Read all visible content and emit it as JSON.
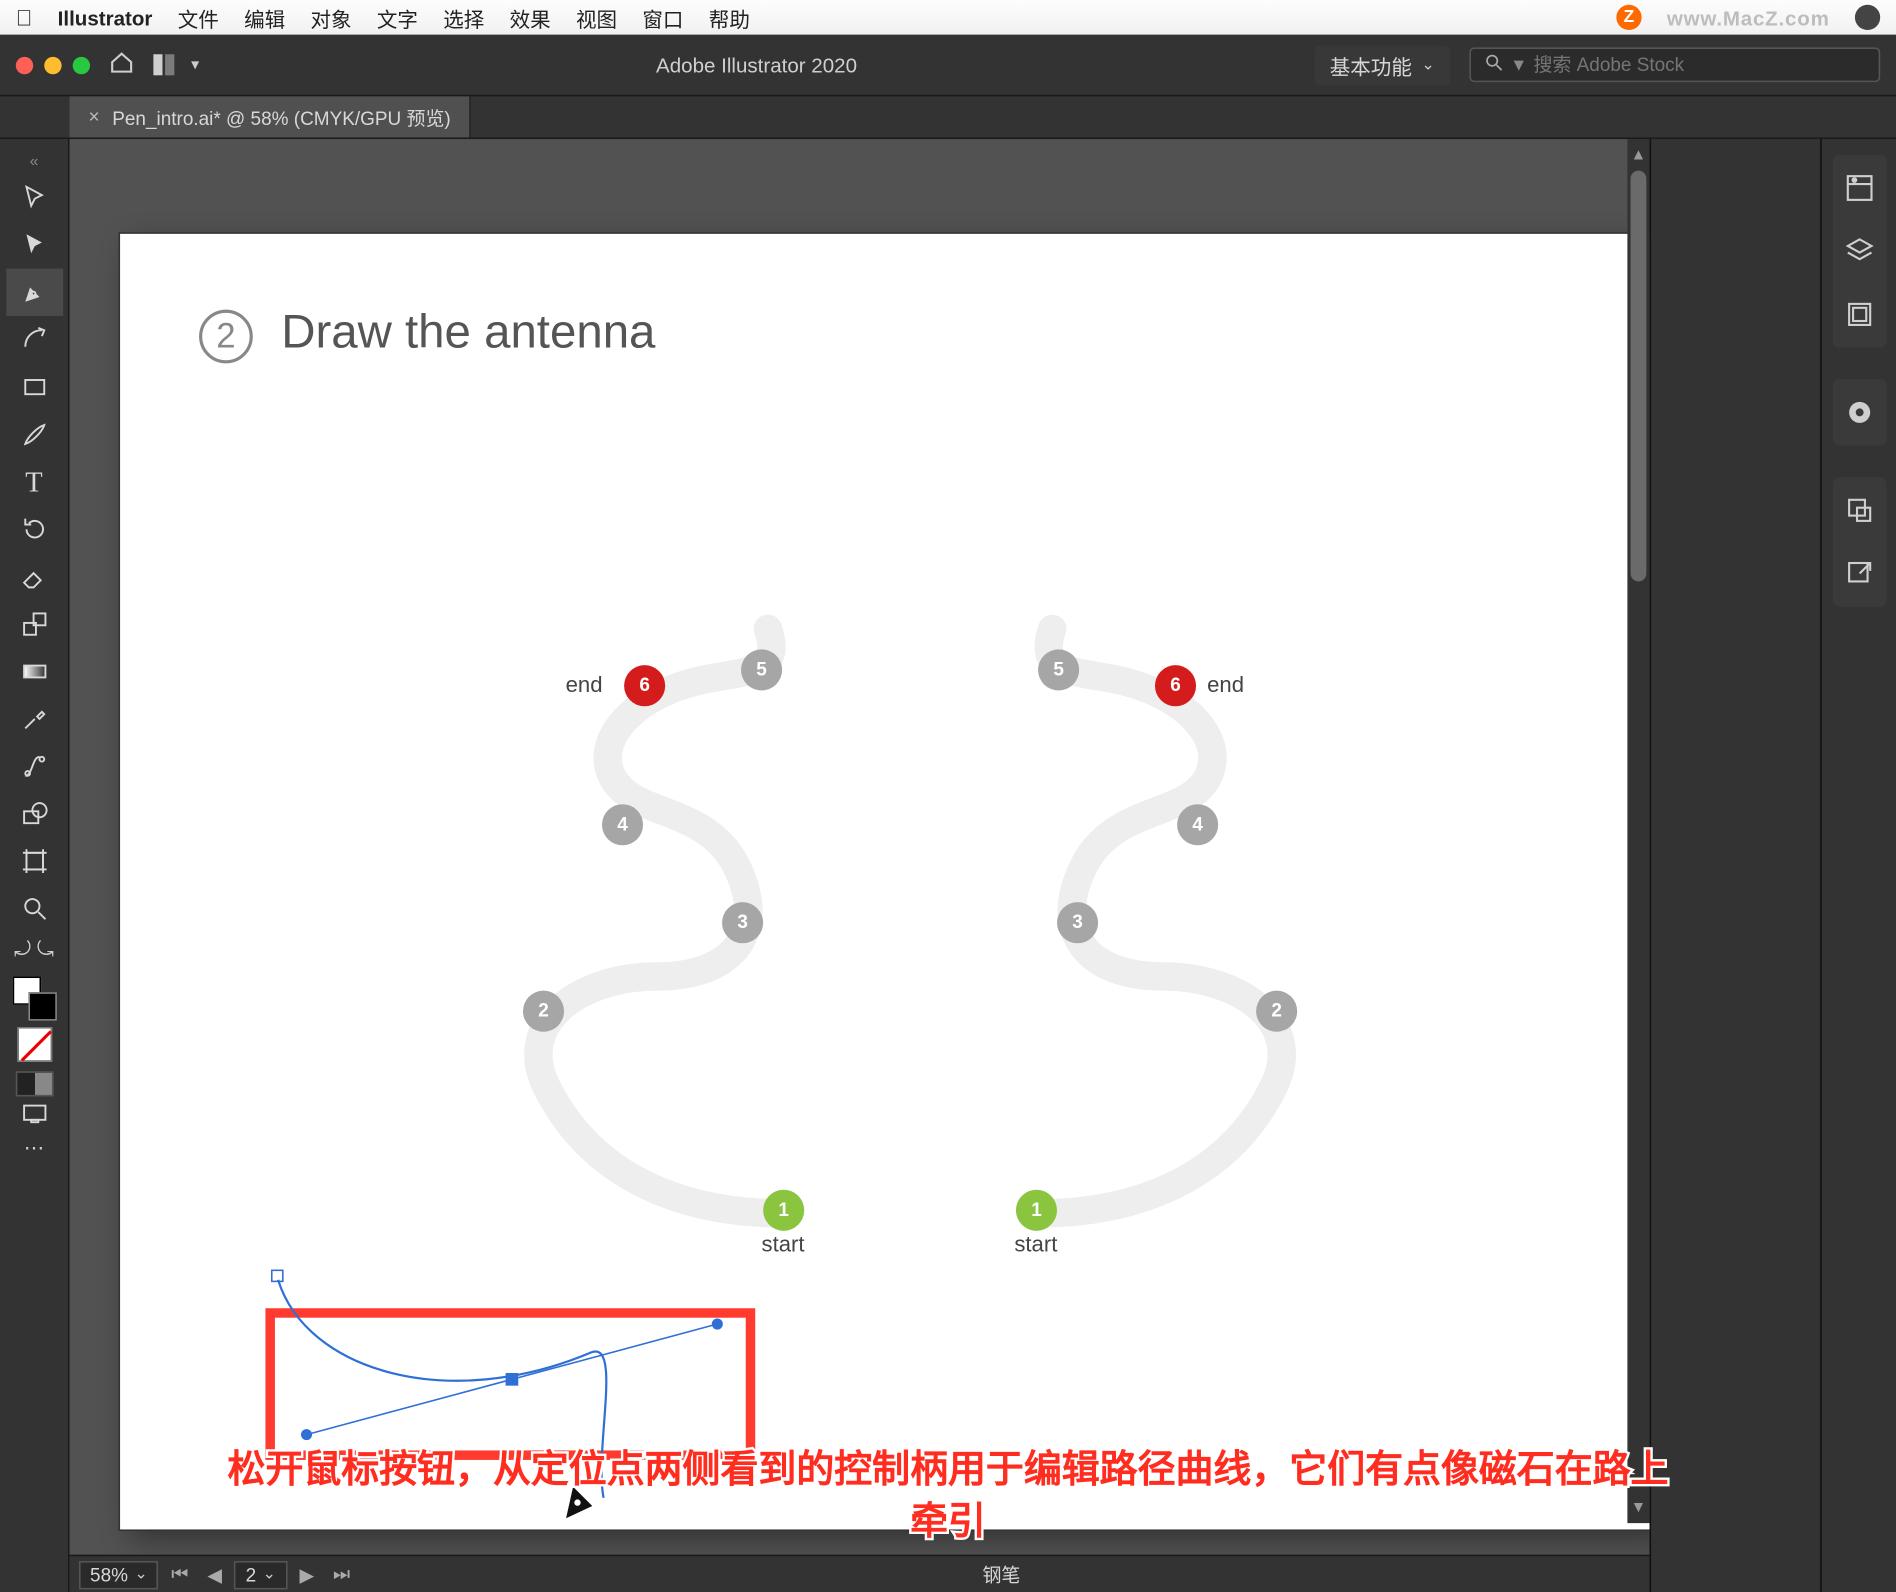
{
  "menubar": {
    "app": "Illustrator",
    "items": [
      "文件",
      "编辑",
      "对象",
      "文字",
      "选择",
      "效果",
      "视图",
      "窗口",
      "帮助"
    ],
    "watermark": "www.MacZ.com",
    "z": "Z"
  },
  "titlebar": {
    "app_title": "Adobe Illustrator 2020",
    "workspace": "基本功能",
    "search_placeholder": "搜索 Adobe Stock"
  },
  "tab": {
    "name": "Pen_intro.ai* @ 58% (CMYK/GPU 预览)"
  },
  "canvas": {
    "heading_num": "2",
    "heading": "Draw the antenna",
    "nodes": {
      "n1": "1",
      "n2": "2",
      "n3": "3",
      "n4": "4",
      "n5": "5",
      "n6": "6",
      "start": "start",
      "end": "end"
    }
  },
  "status": {
    "zoom": "58%",
    "page": "2",
    "tool": "钢笔"
  },
  "caption": {
    "line1": "松开鼠标按钮，从定位点两侧看到的控制柄用于编辑路径曲线，它们有点像磁石在路上",
    "line2": "牵引"
  },
  "tool_names": [
    "selection",
    "direct-selection",
    "pen",
    "curvature",
    "rectangle",
    "paintbrush",
    "type",
    "rotate",
    "eraser",
    "scale",
    "gradient",
    "width",
    "eyedropper",
    "blend",
    "shape-builder",
    "artboard",
    "zoom"
  ],
  "panel_names": [
    "properties",
    "layers",
    "artboards",
    "cc-libraries",
    "appearance",
    "export"
  ]
}
